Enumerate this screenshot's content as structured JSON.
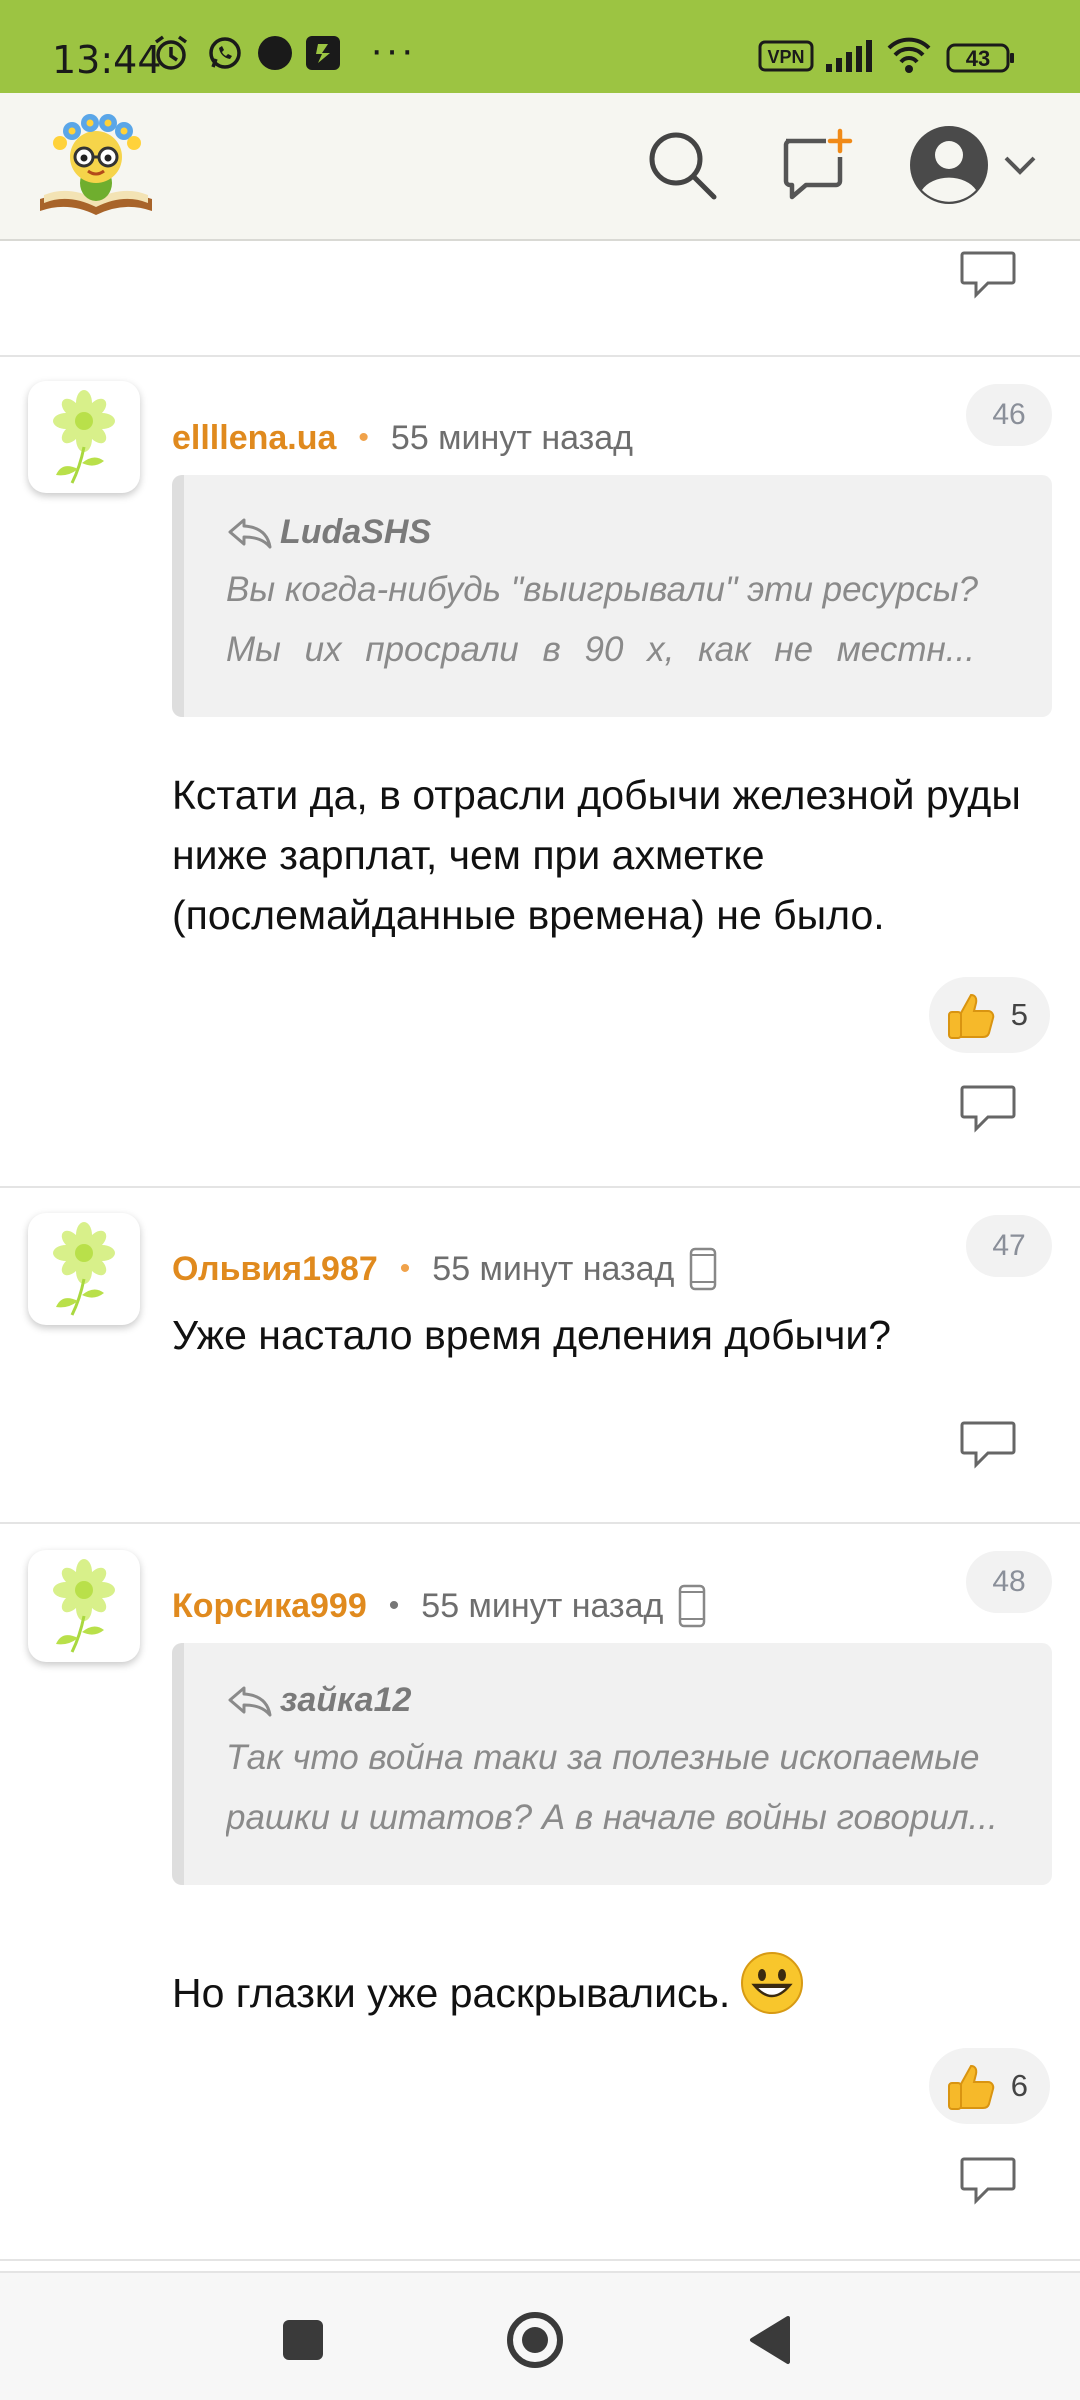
{
  "status_bar": {
    "time": "13:44",
    "vpn": "VPN",
    "battery": "43",
    "more": "···"
  },
  "colors": {
    "status_bar_bg": "#9cc442",
    "author": "#e08a1e",
    "quote_bg": "#f1f1f1"
  },
  "icons": [
    "alarm-icon",
    "whatsapp-icon",
    "circle-dot-icon",
    "app-icon",
    "vpn-icon",
    "signal-icon",
    "wifi-icon",
    "battery-icon",
    "search-icon",
    "new-post-icon",
    "user-avatar-icon",
    "chevron-down-icon",
    "reply-icon",
    "thumbs-up-icon",
    "mobile-device-icon",
    "grin-emoji-icon"
  ],
  "comments": [
    {
      "author": "ellllena.ua",
      "time": "55 минут назад",
      "number": "46",
      "quote_author": "LudaSHS",
      "quote_line1": "Вы когда-нибудь \"выигрывали\" эти ресурсы?",
      "quote_line2": "Мы их просрали в 90 х, как не местн...",
      "text": "Кстати да, в отрасли добычи железной руды ниже зарплат, чем при ахметке (послемайданные времена) не было.",
      "likes": "5"
    },
    {
      "author": "Ольвия1987",
      "time": "55 минут назад",
      "number": "47",
      "text": "Уже настало время деления добычи?"
    },
    {
      "author": "Корсика999",
      "time": "55 минут назад",
      "number": "48",
      "quote_author": "зайка12",
      "quote_line1": "Так что война таки за полезные ископаемые",
      "quote_line2": "рашки и штатов? А в начале войны говорил...",
      "text": "Но глазки уже раскрывались.",
      "likes": "6"
    }
  ]
}
